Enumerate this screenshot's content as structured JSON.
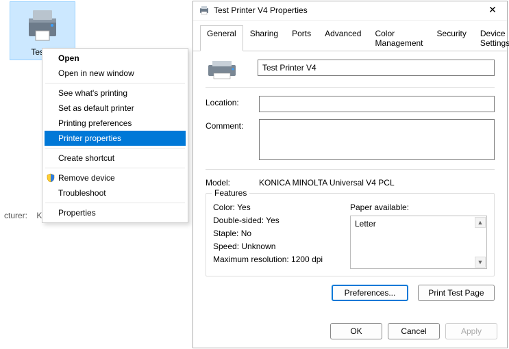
{
  "desktop": {
    "printer_label": "Test P"
  },
  "statusbar": {
    "manufacturer_label": "cturer:",
    "manufacturer_value": "K"
  },
  "context_menu": {
    "open": "Open",
    "open_new_window": "Open in new window",
    "see_whats_printing": "See what's printing",
    "set_default": "Set as default printer",
    "printing_prefs": "Printing preferences",
    "printer_properties": "Printer properties",
    "create_shortcut": "Create shortcut",
    "remove_device": "Remove device",
    "troubleshoot": "Troubleshoot",
    "properties": "Properties"
  },
  "dialog": {
    "title": "Test Printer V4 Properties",
    "tabs": {
      "general": "General",
      "sharing": "Sharing",
      "ports": "Ports",
      "advanced": "Advanced",
      "color_management": "Color Management",
      "security": "Security",
      "device_settings": "Device Settings"
    },
    "general": {
      "name_value": "Test Printer V4",
      "location_label": "Location:",
      "location_value": "",
      "comment_label": "Comment:",
      "comment_value": "",
      "model_label": "Model:",
      "model_value": "KONICA MINOLTA Universal V4 PCL",
      "features_label": "Features",
      "color": "Color: Yes",
      "double_sided": "Double-sided: Yes",
      "staple": "Staple: No",
      "speed": "Speed: Unknown",
      "max_res": "Maximum resolution: 1200 dpi",
      "paper_label": "Paper available:",
      "paper_0": "Letter",
      "preferences_btn": "Preferences...",
      "print_test_btn": "Print Test Page"
    },
    "footer": {
      "ok": "OK",
      "cancel": "Cancel",
      "apply": "Apply"
    }
  }
}
